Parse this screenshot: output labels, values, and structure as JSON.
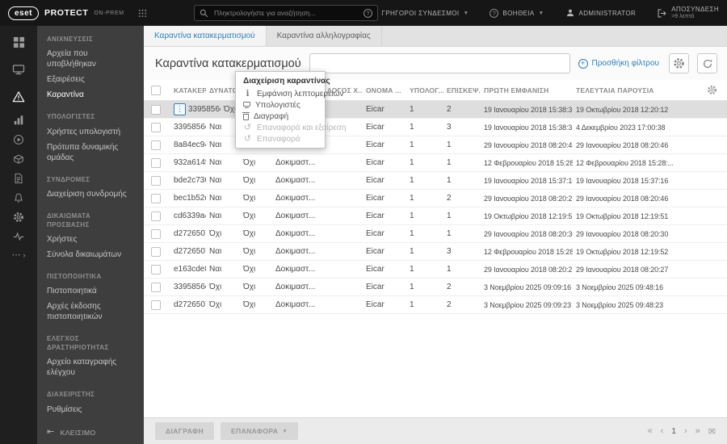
{
  "topbar": {
    "logo_text": "eset",
    "product": "PROTECT",
    "edition": "ON-PREM",
    "search_placeholder": "Πληκτρολογήστε για αναζήτηση...",
    "quick_links": "ΓΡΗΓΟΡΟΙ ΣΥΝΔΕΣΜΟΙ",
    "help": "ΒΟΗΘΕΙΑ",
    "user": "ADMINISTRATOR",
    "logout": "ΑΠΟΣΥΝΔΕΣΗ",
    "logout_timer": ">9 λεπτά"
  },
  "sidebar": {
    "sections": [
      {
        "title": "ΑΝΙΧΝΕΥΣΕΙΣ",
        "items": [
          {
            "label": "Αρχεία που υποβλήθηκαν",
            "active": false
          },
          {
            "label": "Εξαιρέσεις",
            "active": false
          },
          {
            "label": "Καραντίνα",
            "active": true
          }
        ]
      },
      {
        "title": "ΥΠΟΛΟΓΙΣΤΕΣ",
        "items": [
          {
            "label": "Χρήστες υπολογιστή",
            "active": false
          },
          {
            "label": "Πρότυπα δυναμικής ομάδας",
            "active": false
          }
        ]
      },
      {
        "title": "ΣΥΝΔΡΟΜΕΣ",
        "items": [
          {
            "label": "Διαχείριση συνδρομής",
            "active": false
          }
        ]
      },
      {
        "title": "ΔΙΚΑΙΩΜΑΤΑ ΠΡΟΣΒΑΣΗΣ",
        "items": [
          {
            "label": "Χρήστες",
            "active": false
          },
          {
            "label": "Σύνολα δικαιωμάτων",
            "active": false
          }
        ]
      },
      {
        "title": "ΠΙΣΤΟΠΟΙΗΤΙΚΑ",
        "items": [
          {
            "label": "Πιστοποιητικά",
            "active": false
          },
          {
            "label": "Αρχές έκδοσης πιστοποιητικών",
            "active": false
          }
        ]
      },
      {
        "title": "ΕΛΕΓΧΟΣ ΔΡΑΣΤΗΡΙΟΤΗΤΑΣ",
        "items": [
          {
            "label": "Αρχείο καταγραφής ελέγχου",
            "active": false
          }
        ]
      },
      {
        "title": "ΔΙΑΧΕΙΡΙΣΤΗΣ",
        "items": [
          {
            "label": "Ρυθμίσεις",
            "active": false
          }
        ]
      }
    ],
    "close_label": "ΚΛΕΙΣΙΜΟ"
  },
  "tabs": [
    {
      "label": "Καραντίνα κατακερματισμού",
      "active": true
    },
    {
      "label": "Καραντίνα αλληλογραφίας",
      "active": false
    }
  ],
  "page": {
    "title": "Καραντίνα κατακερματισμού",
    "add_filter": "Προσθήκη φίλτρου"
  },
  "table": {
    "columns": [
      "ΚΑΤΑΚΕΡ...",
      "ΔΥΝΑΤΟ...",
      "ΑΝΤΙΚΕΙ...",
      "ΣΗΜΑΙΕΣ...",
      "ΛΟΓΟΣ Χ...",
      "ΟΝΟΜΑ ...",
      "ΥΠΟΛΟΓ...",
      "ΕΠΙΣΚΕΨ...",
      "ΠΡΩΤΗ ΕΜΦΑΝΙΣΗ",
      "ΤΕΛΕΥΤΑΙΑ ΠΑΡΟΥΣΙΑ"
    ],
    "rows": [
      {
        "hash": "3395856c...",
        "restorable": "Όχι",
        "object": "Όχι",
        "flags": "Δοκιμαστ...",
        "reason": "",
        "name": "Eicar",
        "computers": "1",
        "hits": "2",
        "first_seen": "19 Ιανουαρίου 2018 15:38:35",
        "last_seen": "19 Οκτωβρίου 2018 12:20:12",
        "selected": true
      },
      {
        "hash": "3395856c...",
        "restorable": "Ναι",
        "object": "Όχι",
        "flags": "Δοκιμαστ...",
        "reason": "",
        "name": "Eicar",
        "computers": "1",
        "hits": "3",
        "first_seen": "19 Ιανουαρίου 2018 15:38:35",
        "last_seen": "4 Δεκεμβρίου 2023 17:00:38",
        "selected": false
      },
      {
        "hash": "8a84ec94...",
        "restorable": "Ναι",
        "object": "Όχι",
        "flags": "Δοκιμαστ...",
        "reason": "",
        "name": "Eicar",
        "computers": "1",
        "hits": "1",
        "first_seen": "29 Ιανουαρίου 2018 08:20:46",
        "last_seen": "29 Ιανουαρίου 2018 08:20:46",
        "selected": false
      },
      {
        "hash": "932a614f6...",
        "restorable": "Ναι",
        "object": "Όχι",
        "flags": "Δοκιμαστ...",
        "reason": "",
        "name": "Eicar",
        "computers": "1",
        "hits": "1",
        "first_seen": "12 Φεβρουαρίου 2018 15:28:...",
        "last_seen": "12 Φεβρουαρίου 2018 15:28:...",
        "selected": false
      },
      {
        "hash": "bde2c736...",
        "restorable": "Ναι",
        "object": "Όχι",
        "flags": "Δοκιμαστ...",
        "reason": "",
        "name": "Eicar",
        "computers": "1",
        "hits": "1",
        "first_seen": "19 Ιανουαρίου 2018 15:37:16",
        "last_seen": "19 Ιανουαρίου 2018 15:37:16",
        "selected": false
      },
      {
        "hash": "bec1b52d...",
        "restorable": "Ναι",
        "object": "Όχι",
        "flags": "Δοκιμαστ...",
        "reason": "",
        "name": "Eicar",
        "computers": "1",
        "hits": "2",
        "first_seen": "29 Ιανουαρίου 2018 08:20:27",
        "last_seen": "29 Ιανουαρίου 2018 08:20:46",
        "selected": false
      },
      {
        "hash": "cd6339a4...",
        "restorable": "Ναι",
        "object": "Όχι",
        "flags": "Δοκιμαστ...",
        "reason": "",
        "name": "Eicar",
        "computers": "1",
        "hits": "1",
        "first_seen": "19 Οκτωβρίου 2018 12:19:51",
        "last_seen": "19 Οκτωβρίου 2018 12:19:51",
        "selected": false
      },
      {
        "hash": "d2726507...",
        "restorable": "Όχι",
        "object": "Όχι",
        "flags": "Δοκιμαστ...",
        "reason": "",
        "name": "Eicar",
        "computers": "1",
        "hits": "1",
        "first_seen": "29 Ιανουαρίου 2018 08:20:30",
        "last_seen": "29 Ιανουαρίου 2018 08:20:30",
        "selected": false
      },
      {
        "hash": "d2726507...",
        "restorable": "Ναι",
        "object": "Όχι",
        "flags": "Δοκιμαστ...",
        "reason": "",
        "name": "Eicar",
        "computers": "1",
        "hits": "3",
        "first_seen": "12 Φεβρουαρίου 2018 15:28:...",
        "last_seen": "19 Οκτωβρίου 2018 12:19:52",
        "selected": false
      },
      {
        "hash": "e163cde8...",
        "restorable": "Ναι",
        "object": "Όχι",
        "flags": "Δοκιμαστ...",
        "reason": "",
        "name": "Eicar",
        "computers": "1",
        "hits": "1",
        "first_seen": "29 Ιανουαρίου 2018 08:20:27",
        "last_seen": "29 Ιανουαρίου 2018 08:20:27",
        "selected": false
      },
      {
        "hash": "3395856c...",
        "restorable": "Όχι",
        "object": "Όχι",
        "flags": "Δοκιμαστ...",
        "reason": "",
        "name": "Eicar",
        "computers": "1",
        "hits": "2",
        "first_seen": "3 Νοεμβρίου 2025 09:09:16",
        "last_seen": "3 Νοεμβρίου 2025 09:48:16",
        "selected": false
      },
      {
        "hash": "d2726507...",
        "restorable": "Όχι",
        "object": "Όχι",
        "flags": "Δοκιμαστ...",
        "reason": "",
        "name": "Eicar",
        "computers": "1",
        "hits": "2",
        "first_seen": "3 Νοεμβρίου 2025 09:09:23",
        "last_seen": "3 Νοεμβρίου 2025 09:48:23",
        "selected": false
      }
    ]
  },
  "context_menu": {
    "title": "Διαχείριση καραντίνας",
    "items": [
      {
        "label": "Εμφάνιση λεπτομερειών",
        "icon": "info",
        "enabled": true
      },
      {
        "label": "Υπολογιστές",
        "icon": "computer",
        "enabled": true
      },
      {
        "label": "Διαγραφή",
        "icon": "trash",
        "enabled": true
      },
      {
        "label": "Επαναφορά και εξαίρεση",
        "icon": "restore",
        "enabled": false
      },
      {
        "label": "Επαναφορά",
        "icon": "restore",
        "enabled": false
      }
    ]
  },
  "footer": {
    "delete_label": "ΔΙΑΓΡΑΦΗ",
    "restore_label": "ΕΠΑΝΑΦΟΡΑ",
    "page_number": "1"
  },
  "colors": {
    "accent": "#2e7fb8",
    "topbar_bg": "#161616",
    "sidebar_bg": "#3e3e3e",
    "selected_row_bg": "#dedede"
  }
}
